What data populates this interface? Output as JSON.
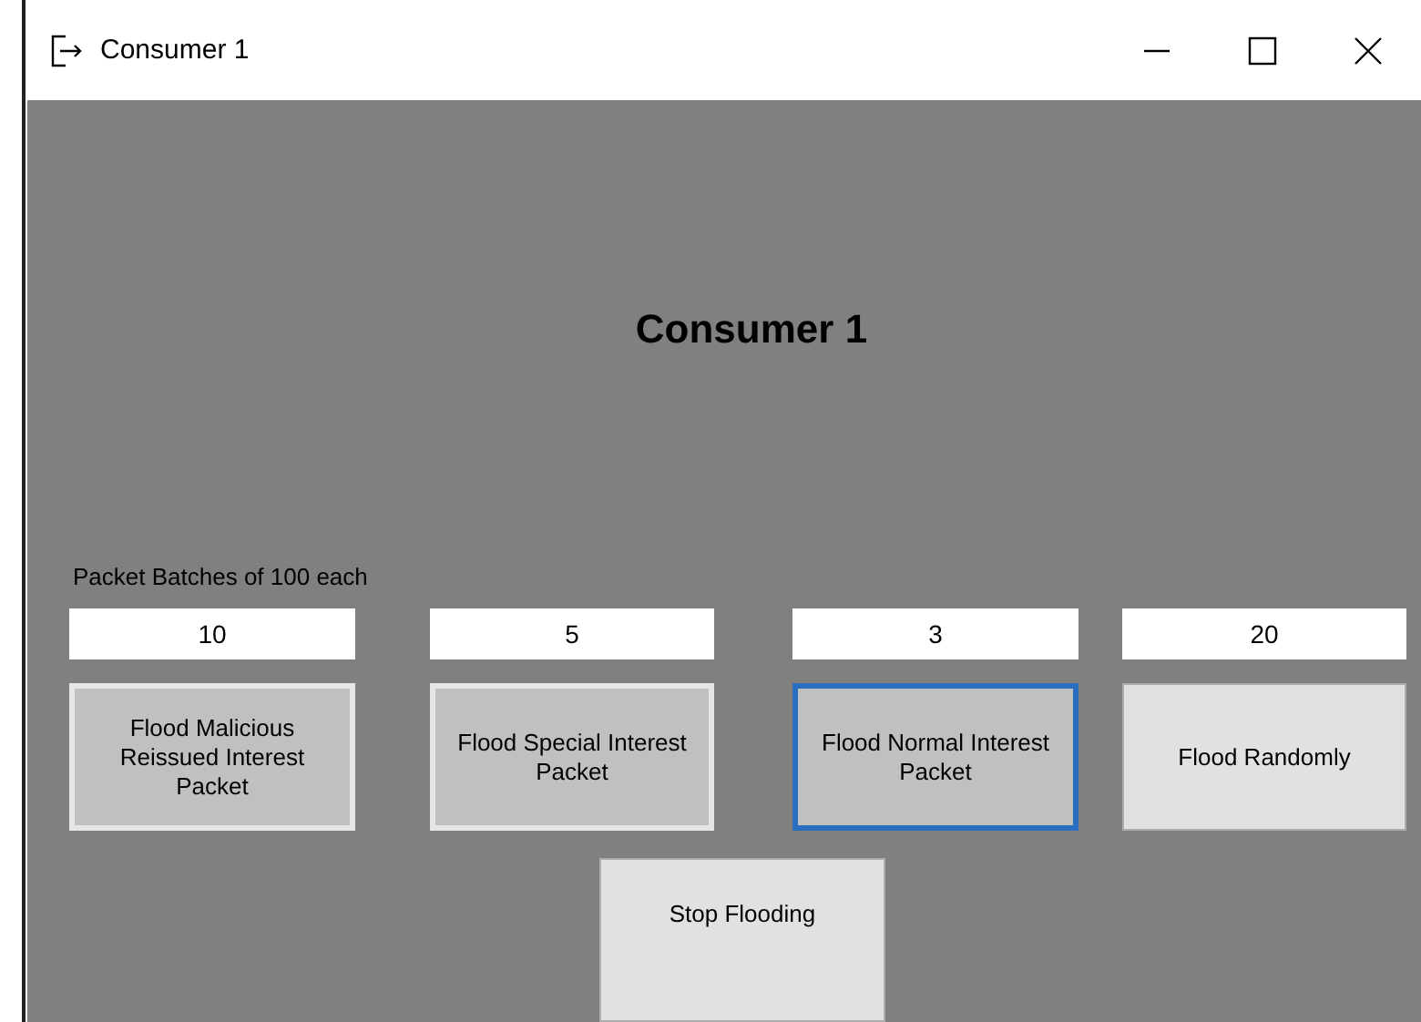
{
  "window": {
    "title": "Consumer 1"
  },
  "heading": "Consumer 1",
  "batch_label": "Packet Batches of 100 each",
  "columns": [
    {
      "field": {
        "value": "10"
      },
      "button": {
        "label": "Flood Malicious Reissued Interest Packet",
        "active": true,
        "focused": false
      }
    },
    {
      "field": {
        "value": "5"
      },
      "button": {
        "label": "Flood Special Interest Packet",
        "active": true,
        "focused": false
      }
    },
    {
      "field": {
        "value": "3"
      },
      "button": {
        "label": "Flood Normal Interest Packet",
        "active": true,
        "focused": true
      }
    },
    {
      "field": {
        "value": "20"
      },
      "button": {
        "label": "Flood Randomly",
        "active": false,
        "focused": false
      }
    }
  ],
  "stop_button": {
    "label": "Stop Flooding"
  }
}
